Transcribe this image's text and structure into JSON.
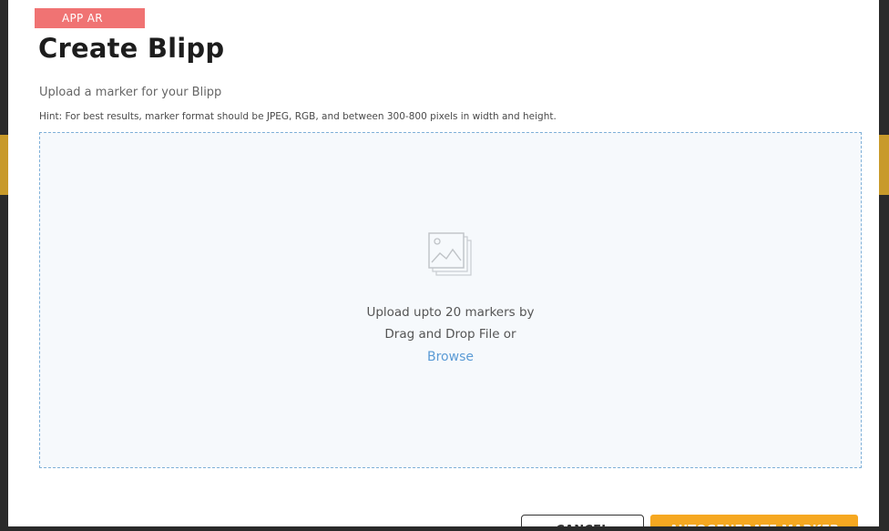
{
  "modal": {
    "tag": "APP AR",
    "title": "Create Blipp",
    "subtitle": "Upload a marker for your Blipp",
    "hint": "Hint: For best results, marker format should be JPEG, RGB, and between 300-800 pixels in width and height."
  },
  "dropzone": {
    "icon": "image-stack-icon",
    "line1": "Upload upto 20 markers by",
    "line2": "Drag and Drop File or",
    "browse_label": "Browse"
  },
  "footer": {
    "cancel_label": "CANCEL",
    "autogenerate_label": "AUTOGENERATE MARKER"
  },
  "colors": {
    "tag_bg": "#f07373",
    "primary_button": "#f6a821",
    "link": "#5b9bd5",
    "dropzone_bg": "#f6f9fc",
    "dropzone_border": "#7fb0d8"
  }
}
